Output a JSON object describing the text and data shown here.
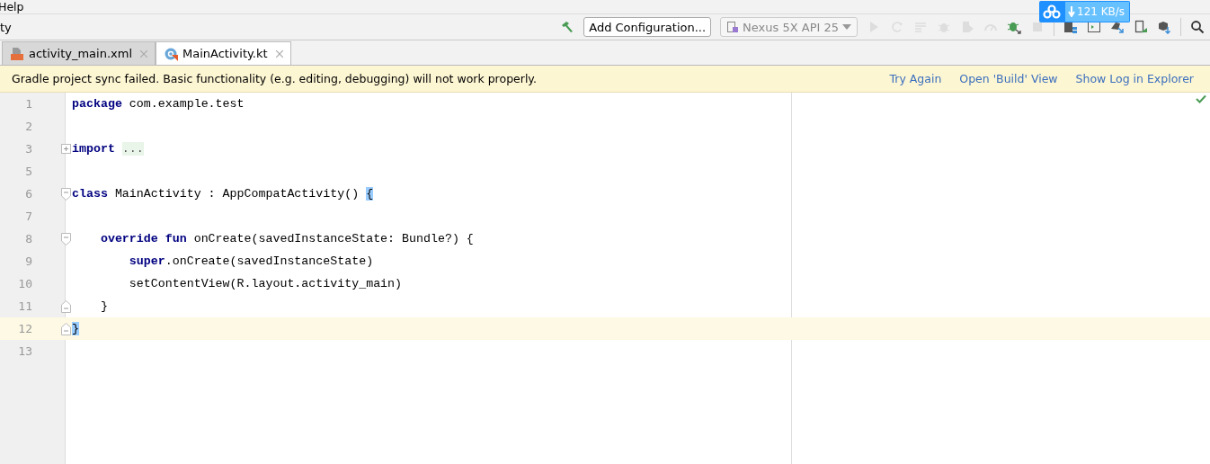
{
  "menu_bar": {
    "items": [
      "Help"
    ]
  },
  "toolbar": {
    "title": "ty",
    "config_button": "Add Configuration...",
    "device": {
      "label": "Nexus 5X API 25",
      "disabled": true
    },
    "icons": [
      {
        "kind": "build",
        "disabled": false
      },
      {
        "kind": "run",
        "disabled": true
      },
      {
        "kind": "apply",
        "disabled": true
      },
      {
        "kind": "apply-code",
        "disabled": true
      },
      {
        "kind": "debug",
        "disabled": true
      },
      {
        "kind": "attach",
        "disabled": true
      },
      {
        "kind": "profile",
        "disabled": true
      },
      {
        "kind": "attach-debugger",
        "disabled": false
      },
      {
        "kind": "stop",
        "disabled": true
      },
      {
        "kind": "sep"
      },
      {
        "kind": "structure",
        "disabled": false
      },
      {
        "kind": "terminal",
        "disabled": false
      },
      {
        "kind": "sync",
        "disabled": false
      },
      {
        "kind": "avd",
        "disabled": false
      },
      {
        "kind": "sdk",
        "disabled": false
      },
      {
        "kind": "sep"
      },
      {
        "kind": "search",
        "disabled": false
      }
    ]
  },
  "speed_widget": {
    "text": "121 KB/s"
  },
  "tabs": [
    {
      "label": "activity_main.xml",
      "kind": "xml",
      "selected": false
    },
    {
      "label": "MainActivity.kt",
      "kind": "kotlin",
      "selected": true
    }
  ],
  "banner": {
    "message": "Gradle project sync failed. Basic functionality (e.g. editing, debugging) will not work properly.",
    "links": [
      "Try Again",
      "Open 'Build' View",
      "Show Log in Explorer"
    ]
  },
  "editor": {
    "lines": [
      {
        "number": "1",
        "current": false,
        "tokens": [
          {
            "text": "package",
            "kind": "keyword"
          },
          {
            "text": " com.example.test",
            "kind": "plain"
          }
        ]
      },
      {
        "number": "2",
        "current": false
      },
      {
        "number": "3",
        "current": false,
        "fold_marker": {
          "kind": "collapsed"
        },
        "tokens": [
          {
            "text": "import ",
            "kind": "keyword"
          },
          {
            "text": "...",
            "kind": "folded"
          }
        ]
      },
      {
        "number": "5",
        "current": false
      },
      {
        "number": "6",
        "current": false,
        "fold_marker": {
          "kind": "start"
        },
        "tokens": [
          {
            "text": "class",
            "kind": "keyword"
          },
          {
            "text": " MainActivity : AppCompatActivity() ",
            "kind": "plain"
          },
          {
            "text": "{",
            "kind": "brace"
          }
        ]
      },
      {
        "number": "7",
        "current": false
      },
      {
        "number": "8",
        "current": false,
        "fold_marker": {
          "kind": "start"
        },
        "tokens": [
          {
            "text": "    override fun",
            "kind": "keyword"
          },
          {
            "text": " onCreate(savedInstanceState: Bundle?) {",
            "kind": "plain"
          }
        ]
      },
      {
        "number": "9",
        "current": false,
        "tokens": [
          {
            "text": "        super",
            "kind": "keyword"
          },
          {
            "text": ".onCreate(savedInstanceState)",
            "kind": "plain"
          }
        ]
      },
      {
        "number": "10",
        "current": false,
        "tokens": [
          {
            "text": "        setContentView(R.layout.activity_main)",
            "kind": "plain"
          }
        ]
      },
      {
        "number": "11",
        "current": false,
        "fold_marker": {
          "kind": "end"
        },
        "tokens": [
          {
            "text": "    }",
            "kind": "plain"
          }
        ]
      },
      {
        "number": "12",
        "current": true,
        "fold_marker": {
          "kind": "end"
        },
        "tokens": [
          {
            "text": "}",
            "kind": "brace"
          }
        ]
      },
      {
        "number": "13",
        "current": false
      }
    ],
    "no_errors": true
  }
}
